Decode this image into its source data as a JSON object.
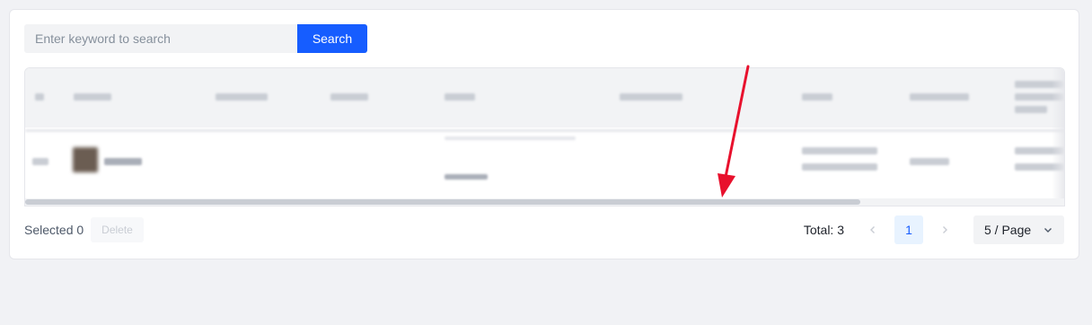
{
  "search": {
    "placeholder": "Enter keyword to search",
    "button_label": "Search"
  },
  "table": {
    "redacted": true,
    "visible_rows": 1
  },
  "footer": {
    "selected_label": "Selected 0",
    "delete_label": "Delete",
    "total_label": "Total: 3",
    "current_page": "1",
    "page_size_label": "5 / Page"
  },
  "colors": {
    "primary": "#165dff",
    "annotation_arrow": "#e8112d"
  },
  "icons": {
    "prev": "chevron-left-icon",
    "next": "chevron-right-icon",
    "dropdown": "chevron-down-icon"
  }
}
